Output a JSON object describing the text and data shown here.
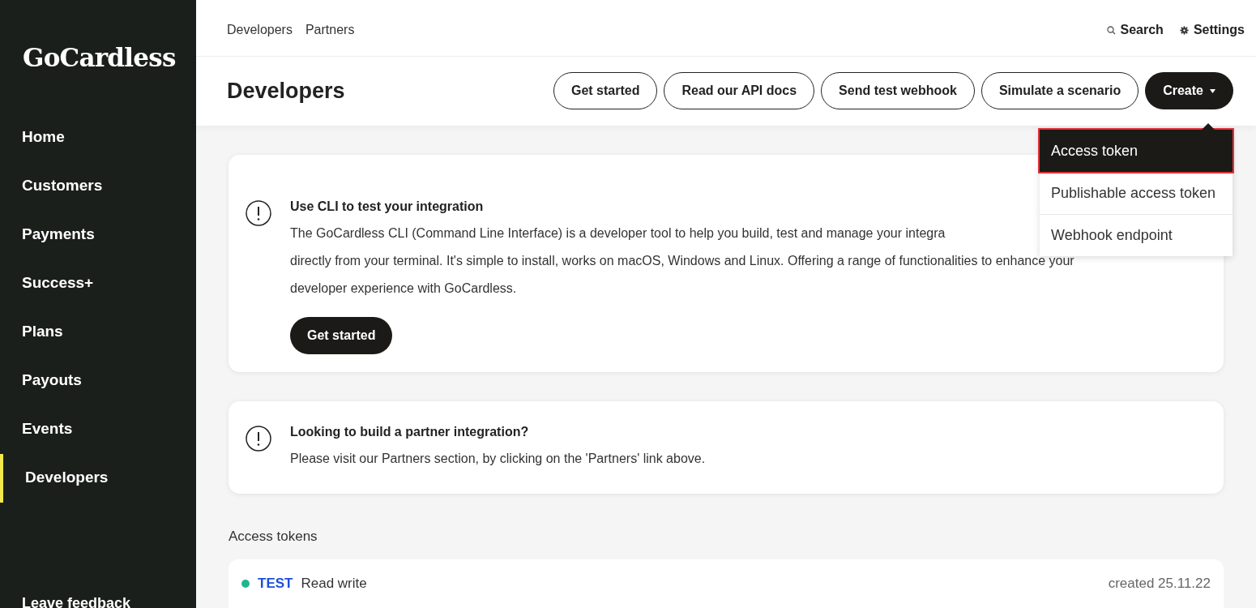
{
  "sidebar": {
    "logo": "GoCardless",
    "items": [
      {
        "label": "Home",
        "selected": false
      },
      {
        "label": "Customers",
        "selected": false
      },
      {
        "label": "Payments",
        "selected": false
      },
      {
        "label": "Success+",
        "selected": false
      },
      {
        "label": "Plans",
        "selected": false
      },
      {
        "label": "Payouts",
        "selected": false
      },
      {
        "label": "Events",
        "selected": false
      },
      {
        "label": "Developers",
        "selected": true
      }
    ],
    "footer_link": "Leave feedback"
  },
  "top_nav": {
    "links": [
      "Developers",
      "Partners"
    ],
    "search": "Search",
    "settings": "Settings"
  },
  "header": {
    "title": "Developers",
    "buttons": [
      {
        "label": "Get started",
        "kind": "outline"
      },
      {
        "label": "Read our API docs",
        "kind": "outline"
      },
      {
        "label": "Send test webhook",
        "kind": "outline"
      },
      {
        "label": "Simulate a scenario",
        "kind": "outline"
      },
      {
        "label": "Create",
        "kind": "dropdown"
      }
    ]
  },
  "create_menu": {
    "items": [
      {
        "label": "Access token",
        "selected": true
      },
      {
        "label": "Publishable access token",
        "selected": false
      },
      {
        "label": "Webhook endpoint",
        "selected": false
      }
    ]
  },
  "cards": [
    {
      "title": "Use CLI to test your integration",
      "lines": [
        "The GoCardless CLI (Command Line Interface) is a developer tool to help you build, test and manage your integra",
        "directly from your terminal. It's simple to install, works on macOS, Windows and Linux. Offering a range of functionalities to enhance your",
        "developer experience with GoCardless."
      ],
      "button": "Get started"
    },
    {
      "title": "Looking to build a partner integration?",
      "lines": [
        "Please visit our Partners section, by clicking on the 'Partners' link above."
      ]
    }
  ],
  "access_tokens": {
    "heading": "Access tokens",
    "rows": [
      {
        "environment": "TEST",
        "color": "#1fb58f",
        "name": "Read write",
        "created": "created 25.11.22"
      }
    ]
  }
}
